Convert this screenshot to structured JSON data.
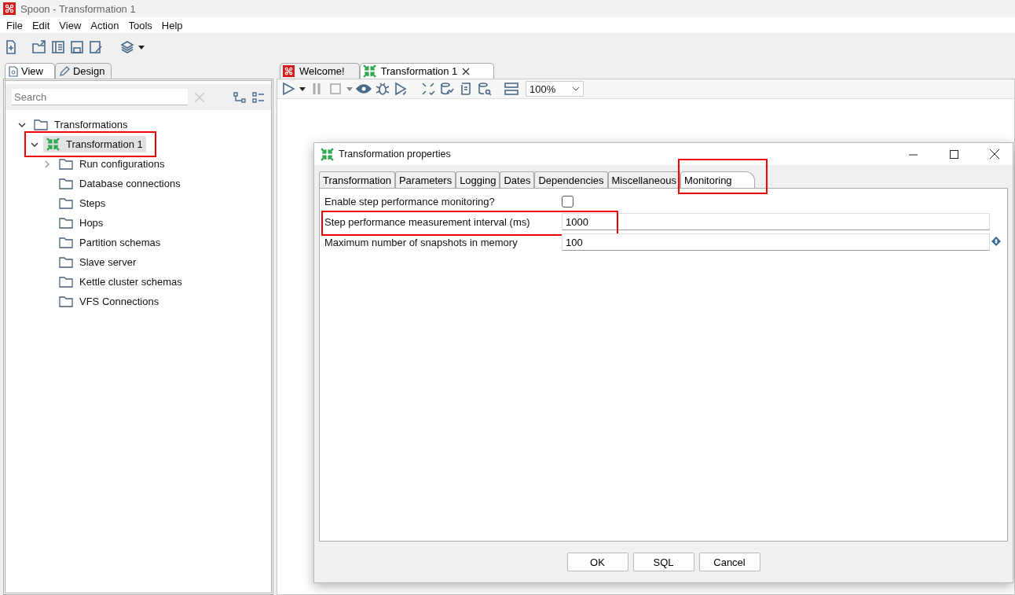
{
  "window": {
    "title": "Spoon - Transformation 1"
  },
  "menu": [
    "File",
    "Edit",
    "View",
    "Action",
    "Tools",
    "Help"
  ],
  "left_tabs": [
    {
      "label": "View",
      "kind": "view",
      "selected": true
    },
    {
      "label": "Design",
      "kind": "design",
      "selected": false
    }
  ],
  "search": {
    "placeholder": "Search"
  },
  "tree": [
    {
      "label": "Transformations",
      "kind": "folder",
      "expanded": true,
      "selected": false,
      "highlighted": false,
      "children": [
        {
          "label": "Transformation 1",
          "kind": "transformation",
          "expanded": true,
          "selected": true,
          "highlighted": true,
          "children": [
            {
              "label": "Run configurations",
              "kind": "folder",
              "expanded": false,
              "selected": false,
              "highlighted": false
            },
            {
              "label": "Database connections",
              "kind": "folder",
              "selected": false,
              "highlighted": false
            },
            {
              "label": "Steps",
              "kind": "folder",
              "selected": false,
              "highlighted": false
            },
            {
              "label": "Hops",
              "kind": "folder",
              "selected": false,
              "highlighted": false
            },
            {
              "label": "Partition schemas",
              "kind": "folder",
              "selected": false,
              "highlighted": false
            },
            {
              "label": "Slave server",
              "kind": "folder",
              "selected": false,
              "highlighted": false
            },
            {
              "label": "Kettle cluster schemas",
              "kind": "folder",
              "selected": false,
              "highlighted": false
            },
            {
              "label": "VFS Connections",
              "kind": "folder",
              "selected": false,
              "highlighted": false
            }
          ]
        }
      ]
    }
  ],
  "editor_tabs": [
    {
      "label": "Welcome!",
      "kind": "welcome",
      "selected": false,
      "closable": false
    },
    {
      "label": "Transformation 1",
      "kind": "transformation",
      "selected": true,
      "closable": true
    }
  ],
  "zoom": {
    "value": "100%"
  },
  "dialog": {
    "title": "Transformation properties",
    "tabs": [
      {
        "label": "Transformation",
        "selected": false,
        "highlighted": false
      },
      {
        "label": "Parameters",
        "selected": false,
        "highlighted": false
      },
      {
        "label": "Logging",
        "selected": false,
        "highlighted": false
      },
      {
        "label": "Dates",
        "selected": false,
        "highlighted": false
      },
      {
        "label": "Dependencies",
        "selected": false,
        "highlighted": false
      },
      {
        "label": "Miscellaneous",
        "selected": false,
        "highlighted": false
      },
      {
        "label": "Monitoring",
        "selected": true,
        "highlighted": true
      }
    ],
    "fields": [
      {
        "kind": "checkbox",
        "label": "Enable step performance monitoring?",
        "checked": false,
        "highlighted": false
      },
      {
        "kind": "text",
        "label": "Step performance measurement interval (ms)",
        "value": "1000",
        "variable": false,
        "highlighted": true
      },
      {
        "kind": "text",
        "label": "Maximum number of snapshots in memory",
        "value": "100",
        "variable": true,
        "highlighted": false
      }
    ],
    "buttons": [
      "OK",
      "SQL",
      "Cancel"
    ]
  }
}
